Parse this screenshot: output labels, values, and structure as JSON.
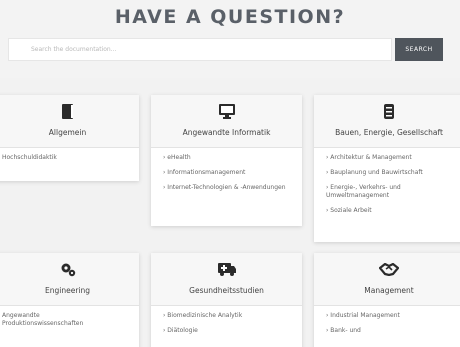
{
  "header": {
    "title": "HAVE A QUESTION?"
  },
  "search": {
    "placeholder": "Search the documentation...",
    "button_label": "SEARCH"
  },
  "categories": [
    {
      "title": "Allgemein",
      "icon": "book-icon",
      "items": [
        "Hochschuldidaktik"
      ]
    },
    {
      "title": "Angewandte Informatik",
      "icon": "monitor-icon",
      "items": [
        "› eHealth",
        "› Informationsmanagement",
        "› Internet-Technologien & -Anwendungen"
      ]
    },
    {
      "title": "Bauen, Energie, Gesellschaft",
      "icon": "server-icon",
      "items": [
        "› Architektur & Management",
        "› Bauplanung und Bauwirtschaft",
        "› Energie-, Verkehrs- und Umweltmanagement",
        "› Soziale Arbeit"
      ]
    },
    {
      "title": "Engineering",
      "icon": "gears-icon",
      "items": [
        "Angewandte Produktionswissenschaften"
      ]
    },
    {
      "title": "Gesundheitsstudien",
      "icon": "ambulance-icon",
      "items": [
        "› Biomedizinische Analytik",
        "› Diätologie"
      ]
    },
    {
      "title": "Management",
      "icon": "handshake-icon",
      "items": [
        "› Industrial Management",
        "› Bank- und"
      ]
    }
  ]
}
